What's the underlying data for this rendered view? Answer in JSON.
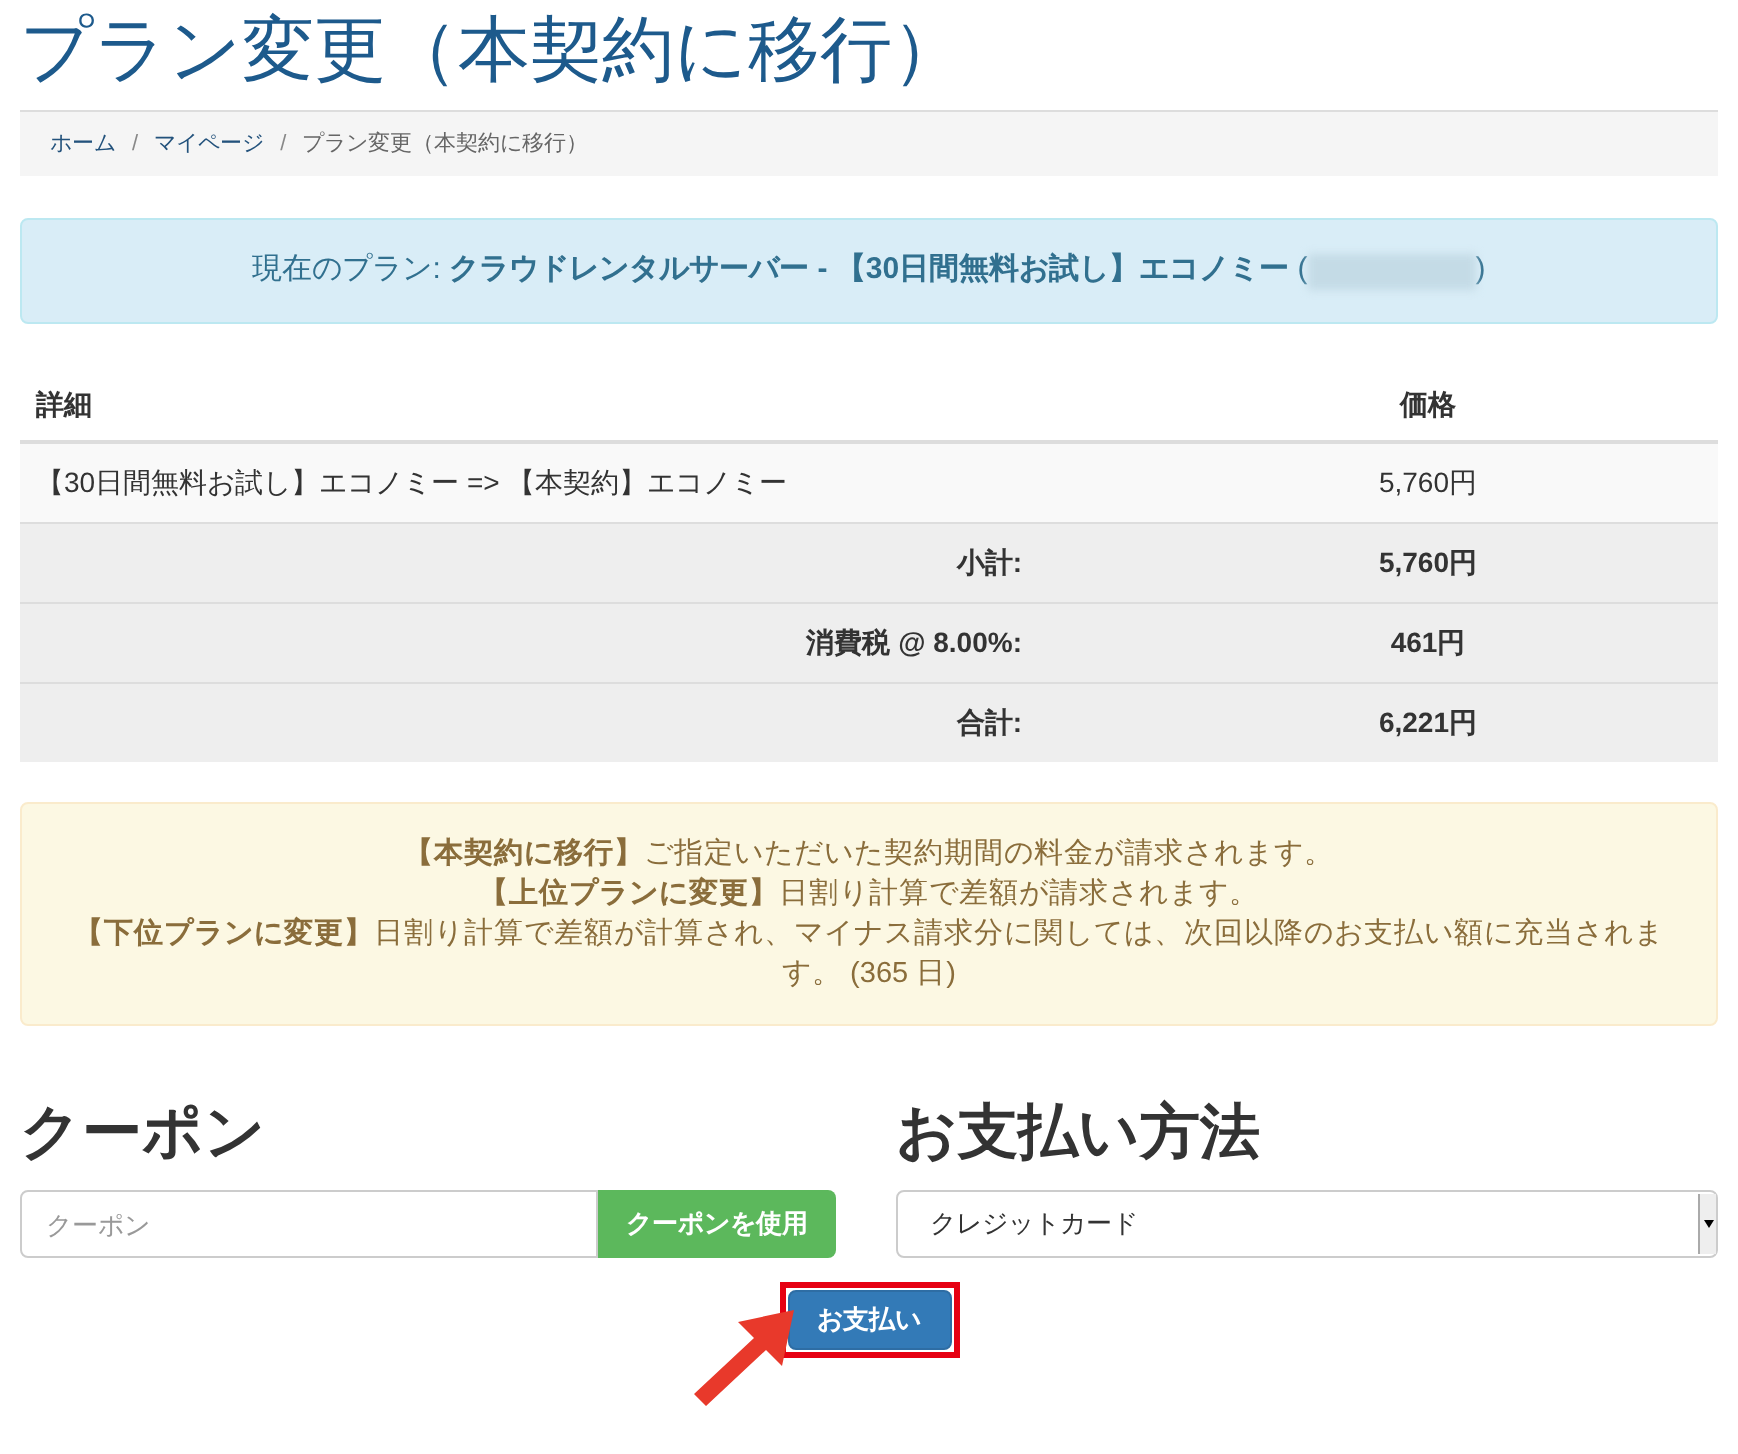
{
  "page_title": "プラン変更（本契約に移行）",
  "breadcrumb_separator": "/",
  "breadcrumb": [
    {
      "label": "ホーム",
      "link": true
    },
    {
      "label": "マイページ",
      "link": true
    },
    {
      "label": "プラン変更（本契約に移行）",
      "link": false
    }
  ],
  "current_plan": {
    "text": "現在のプラン: **クラウドレンタルサーバー - 【30日間無料お試し】エコノミー** (",
    "close": ")",
    "redacted": true
  },
  "table": {
    "columns": [
      "詳細",
      "価格"
    ],
    "rows": [
      {
        "kind": "item",
        "detail": "【30日間無料お試し】エコノミー => 【本契約】エコノミー",
        "price": "5,760円"
      },
      {
        "kind": "total",
        "detail": "小計:",
        "price": "5,760円"
      },
      {
        "kind": "total",
        "detail": "消費税 @ 8.00%:",
        "price": "461円"
      },
      {
        "kind": "total",
        "detail": "合計:",
        "price": "6,221円"
      }
    ]
  },
  "notice": [
    "**【本契約に移行】**ご指定いただいた契約期間の料金が請求されます。",
    "**【上位プランに変更】**日割り計算で差額が請求されます。",
    "**【下位プランに変更】**日割り計算で差額が計算され、マイナス請求分に関しては、次回以降のお支払い額に充当されます。 (365 日)"
  ],
  "coupon": {
    "heading": "クーポン",
    "placeholder": "クーポン",
    "button": "クーポンを使用"
  },
  "payment": {
    "heading": "お支払い方法",
    "value": "クレジットカード"
  },
  "pay_button": {
    "label": "お支払い",
    "highlighted": true
  }
}
